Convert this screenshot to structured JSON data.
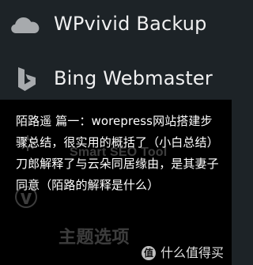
{
  "menu": {
    "items": [
      {
        "label": "WPvivid Backup",
        "icon": "cloud-icon"
      },
      {
        "label": "Bing Webmaster",
        "icon": "bing-icon"
      }
    ]
  },
  "popup": {
    "text": "陌路遥 篇一：worepress网站搭建步骤总结，很实用的概括了（小白总结）刀郎解释了与云朵同居缘由，是其妻子同意（陌路的解释是什么）"
  },
  "background_overlay": {
    "top_text": "Smart SEO Tool",
    "bottom_text": "主题选项"
  },
  "watermark": {
    "badge_text": "值",
    "text": "什么值得买"
  },
  "colors": {
    "menu_background": "#1d2327",
    "menu_text": "#f0f0f1",
    "icon_color": "#a7aaad",
    "popup_background": "#000000",
    "popup_text": "#ffffff"
  }
}
